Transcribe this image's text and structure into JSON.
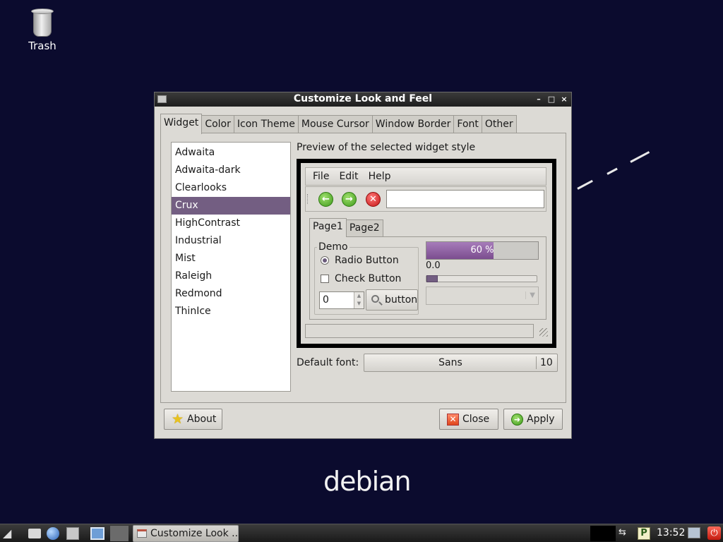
{
  "desktop": {
    "trash_label": "Trash",
    "logo_text": "debian"
  },
  "window": {
    "title": "Customize Look and Feel",
    "controls": {
      "minimize": "–",
      "maximize": "□",
      "close": "×"
    },
    "tabs": [
      "Widget",
      "Color",
      "Icon Theme",
      "Mouse Cursor",
      "Window Border",
      "Font",
      "Other"
    ],
    "active_tab": "Widget",
    "themes": [
      "Adwaita",
      "Adwaita-dark",
      "Clearlooks",
      "Crux",
      "HighContrast",
      "Industrial",
      "Mist",
      "Raleigh",
      "Redmond",
      "ThinIce"
    ],
    "selected_theme": "Crux",
    "preview": {
      "label": "Preview of the selected widget style",
      "menus": [
        "File",
        "Edit",
        "Help"
      ],
      "tabs": [
        "Page1",
        "Page2"
      ],
      "demo_title": "Demo",
      "radio_label": "Radio Button",
      "check_label": "Check Button",
      "spin_value": "0",
      "button_label": "button",
      "progress_text": "60 %",
      "progress_fraction": 0.6,
      "scale_value": "0.0"
    },
    "default_font_label": "Default font:",
    "default_font_name": "Sans",
    "default_font_size": "10",
    "buttons": {
      "about": "About",
      "close": "Close",
      "apply": "Apply"
    }
  },
  "taskbar": {
    "task_label": "Customize Look ...",
    "clock": "13:52"
  },
  "colors": {
    "desktop_bg": "#0b0b2e",
    "selection": "#735e82",
    "progress": "#7b4d8f"
  }
}
